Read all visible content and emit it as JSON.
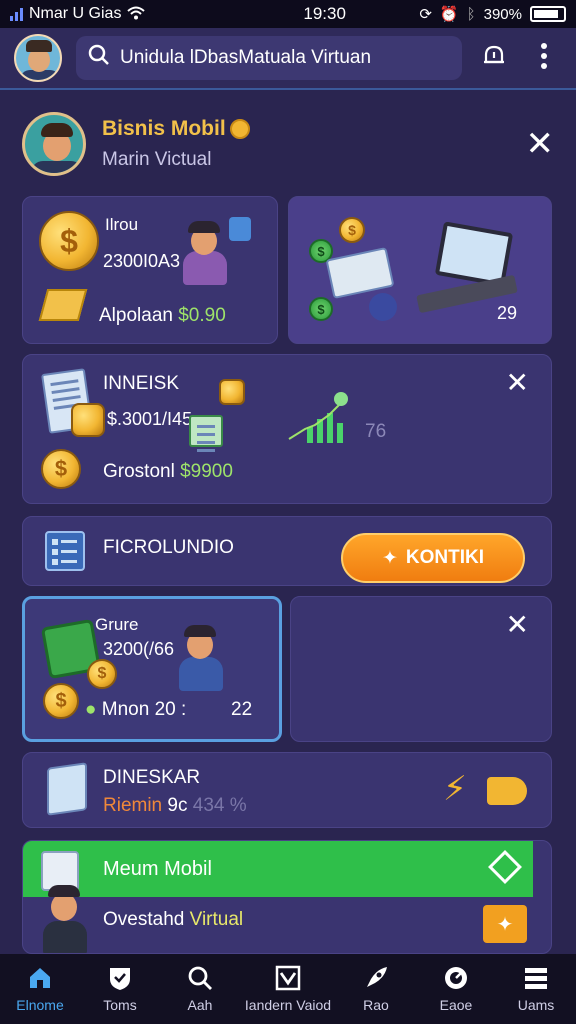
{
  "status_bar": {
    "carrier": "Nmar U Gias",
    "time": "19:30",
    "battery": "390%"
  },
  "top_bar": {
    "search_text": "Unidula lDbasMatuala Virtuan"
  },
  "header": {
    "title": "Bisnis Mobil",
    "subtitle": "Marin Victual"
  },
  "cards": {
    "loan": {
      "tag": "Ilrou",
      "amount": "2300I0A3",
      "label": "Alpolaan",
      "value": "$0.90"
    },
    "laptop": {
      "value": "29"
    },
    "invest": {
      "title": "INNEISK",
      "amount": "$.3001/I45",
      "label": "Grostonl",
      "value": "$9900",
      "stat": "76"
    },
    "promo": {
      "title": "FICROLUNDIO",
      "button": "KONTIKI"
    },
    "store": {
      "tag": "Grure",
      "amount": "3200(/66",
      "label": "Mnon",
      "num": "20 :",
      "value": "22"
    },
    "disk": {
      "title": "DINESKAR",
      "label": "Riemin",
      "value": "9c",
      "stat": "434 %"
    },
    "mission": {
      "banner": "Meum Mobil",
      "label": "Ovestahd",
      "label_accent": "Virtual"
    }
  },
  "bottom_nav": [
    {
      "label": "Elnome",
      "icon": "home-icon"
    },
    {
      "label": "Toms",
      "icon": "shield-icon"
    },
    {
      "label": "Aah",
      "icon": "search-icon"
    },
    {
      "label": "Iandern Vaiod",
      "icon": "check-icon"
    },
    {
      "label": "Rao",
      "icon": "rocket-icon"
    },
    {
      "label": "Eaoe",
      "icon": "gauge-icon"
    },
    {
      "label": "Uams",
      "icon": "list-icon"
    }
  ],
  "colors": {
    "background": "#2a2550",
    "card": "#3a3470",
    "accent_orange": "#f07d10",
    "accent_green": "#2fbf4a",
    "gold": "#f2c14a",
    "active_nav": "#4aa8f0"
  }
}
